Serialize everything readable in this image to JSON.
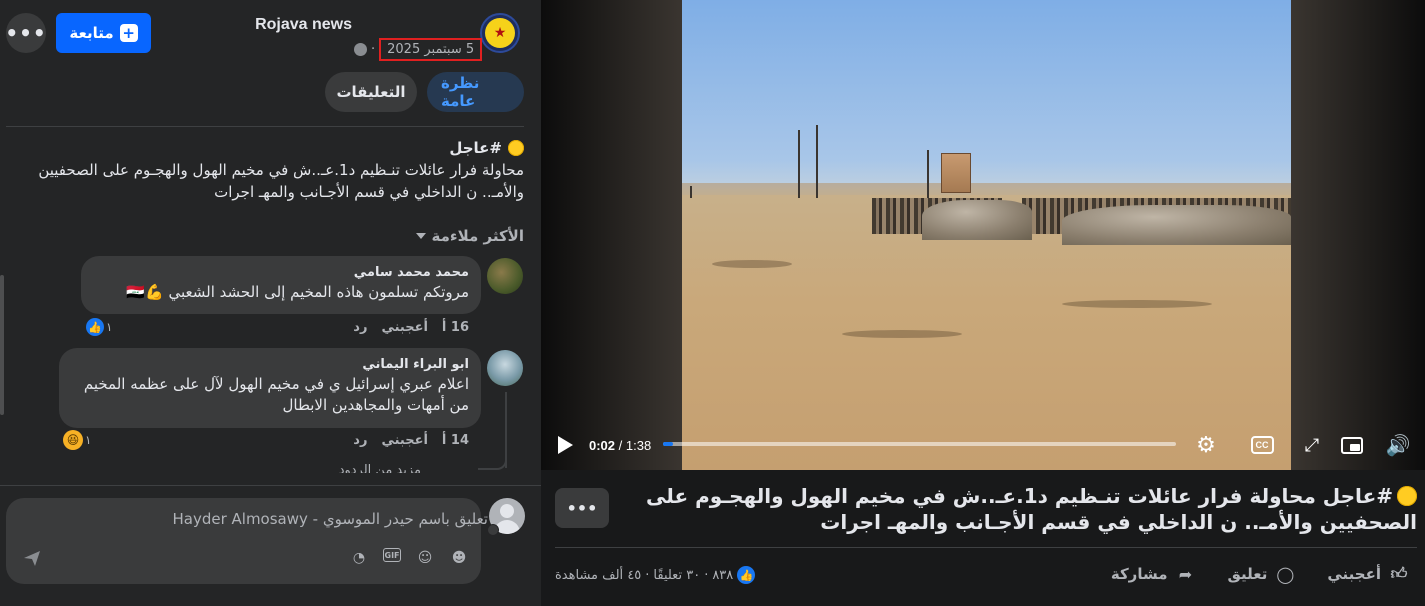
{
  "header": {
    "page_name": "Rojava news",
    "date": "5 سبتمبر 2025",
    "follow_label": "متابعة",
    "more_label": "•••"
  },
  "tabs": [
    {
      "label": "نظرة عامة",
      "active": true
    },
    {
      "label": "التعليقات",
      "active": false
    }
  ],
  "post": {
    "title": "#عاجل",
    "body": "محاولة فرار عائلات تنـظيم د1.عـ..ش في مخيم الهول والهجـوم على الصحفيين والأمـ.. ن الداخلي في قسم الأجـانب والمهـ اجرات"
  },
  "comments_filter": "الأكثر ملاءمة",
  "comments": [
    {
      "author": "محمد محمد سامي",
      "text": "مروتكم تسلمون هاذه المخيم إلى الحشد الشعبي 💪🇮🇶",
      "time": "16 أ",
      "like_label": "أعجبني",
      "reply_label": "رد",
      "reaction_count": "١",
      "reaction": "like"
    },
    {
      "author": "ابو البراء اليماني",
      "text": "اعلام عبري إسرائيل ي في مخيم الهول لآل على عظمه المخيم من أمهات والمجاهدين الابطال",
      "time": "14 أ",
      "like_label": "أعجبني",
      "reply_label": "رد",
      "reaction_count": "١",
      "reaction": "haha"
    }
  ],
  "cut_reply_text": "مزید من الردود",
  "composer": {
    "placeholder": "تعليق باسم حيدر الموسوي - Hayder Almosawy",
    "gif_label": "GIF"
  },
  "video": {
    "current_time": "0:02",
    "duration": "1:38",
    "progress_fraction": 0.02,
    "cc_label": "CC"
  },
  "right_post": {
    "title": "#عاجل محاولة فرار عائلات تنـظيم د1.عـ..ش في مخيم الهول والهجـوم على الصحفيين والأمـ.. ن الداخلي في قسم الأجـانب والمهـ اجرات",
    "reactions_count": "٨٣٨",
    "comments_count": "٣٠ تعليقًا",
    "views": "٤٥ ألف مشاهدة",
    "separator": "·",
    "like_label": "أعجبني",
    "comment_label": "تعليق",
    "share_label": "مشاركة"
  },
  "colors": {
    "accent": "#0866ff",
    "date_highlight": "#e02020",
    "panel_bg": "#242526",
    "page_bg": "#18191a"
  }
}
